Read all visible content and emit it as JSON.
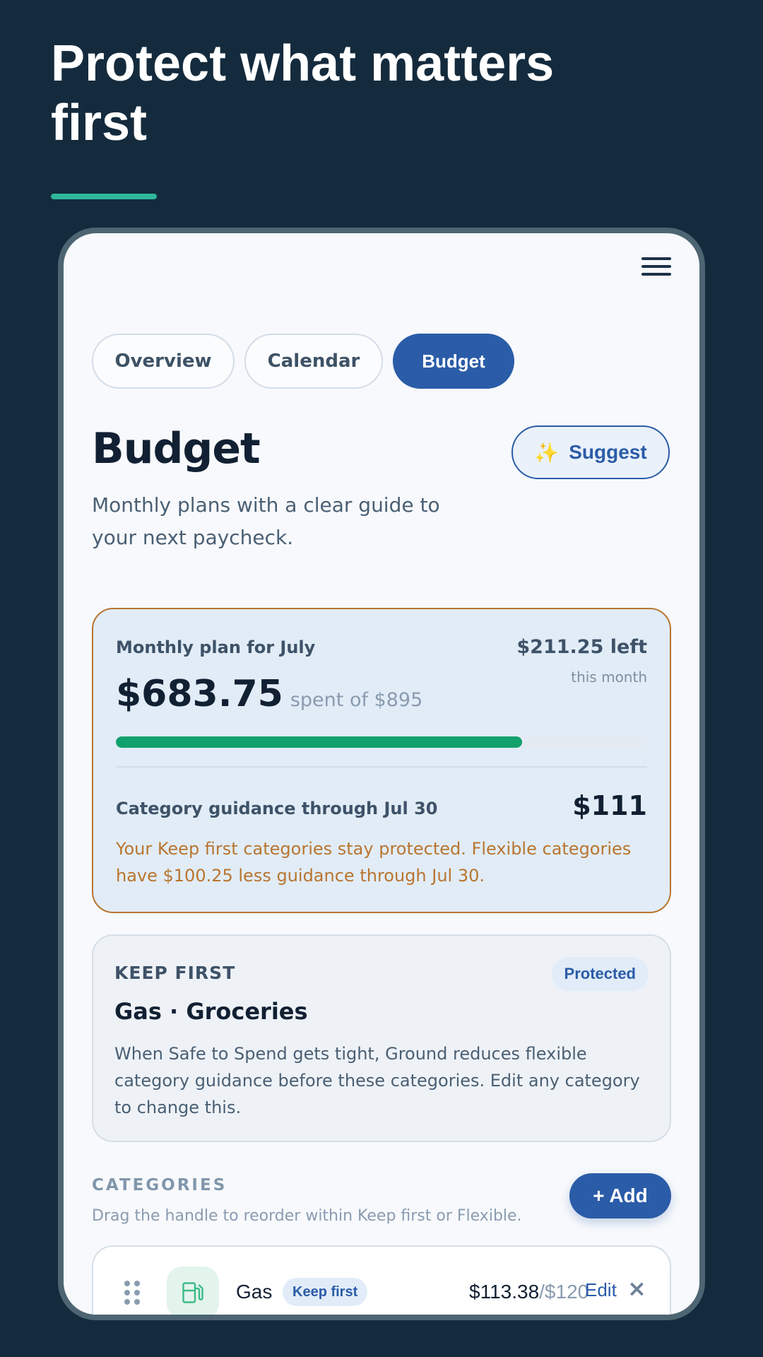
{
  "headline": "Protect what matters first",
  "tabs": {
    "overview": "Overview",
    "calendar": "Calendar",
    "budget": "Budget"
  },
  "page": {
    "title": "Budget",
    "subtitle": "Monthly plans with a clear guide to your next paycheck.",
    "suggest_label": "Suggest",
    "suggest_icon": "✨"
  },
  "plan": {
    "label": "Monthly plan for July",
    "left_amount": "$211.25 left",
    "left_caption": "this month",
    "spent": "$683.75",
    "spent_of": "spent of $895",
    "progress_fraction": 0.764,
    "guidance_label": "Category guidance through Jul 30",
    "guidance_amount": "$111",
    "guidance_note": "Your Keep first categories stay protected. Flexible categories have $100.25 less guidance through Jul 30."
  },
  "keep_first": {
    "eyebrow": "KEEP FIRST",
    "badge": "Protected",
    "title": "Gas · Groceries",
    "body": "When Safe to Spend gets tight, Ground reduces flexible category guidance before these categories. Edit any category to change this."
  },
  "categories": {
    "eyebrow": "CATEGORIES",
    "hint": "Drag the handle to reorder within Keep first or Flexible.",
    "add_label": "+ Add",
    "items": [
      {
        "name": "Gas",
        "badge": "Keep first",
        "spent": "$113.38",
        "total": "/$120",
        "edit_label": "Edit",
        "remove_label": "×",
        "icon": "fuel-pump-icon"
      }
    ]
  },
  "colors": {
    "background": "#142b3d",
    "accent": "#2fb79a",
    "primary": "#2b5ca8",
    "progress": "#12a06c",
    "warning": "#b9752f"
  }
}
